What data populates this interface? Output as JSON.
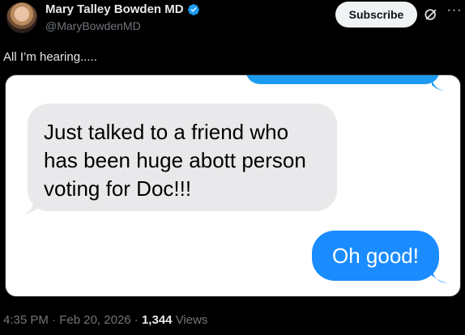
{
  "author": {
    "name": "Mary Talley Bowden MD",
    "handle": "@MaryBowdenMD",
    "verified": true
  },
  "actions": {
    "subscribe_label": "Subscribe",
    "grok_icon": "grok-icon",
    "more_icon": "more-icon"
  },
  "tweet": {
    "text": "All I’m hearing.....",
    "image": {
      "incoming_message": "Just talked to a friend who has been huge abott person voting for Doc!!!",
      "outgoing_message": "Oh good!"
    }
  },
  "meta": {
    "time": "4:35 PM",
    "separator": "·",
    "date": "Feb 20, 2026",
    "views_count": "1,344",
    "views_label": "Views"
  },
  "colors": {
    "background": "#000000",
    "text": "#e7e9ea",
    "muted": "#71767b",
    "verified": "#1d9bf0",
    "imessage_blue": "#1a8cff",
    "imessage_grey": "#e9e9eb"
  }
}
